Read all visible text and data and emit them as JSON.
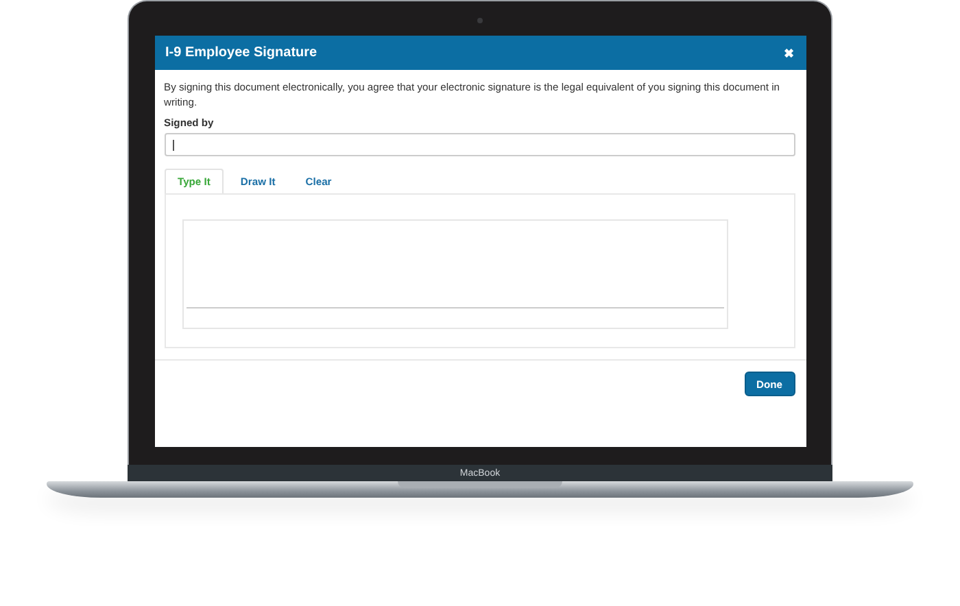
{
  "device": {
    "brand": "MacBook"
  },
  "dialog": {
    "title": "I-9 Employee Signature",
    "close": "✖",
    "description": "By signing this document electronically, you agree that your electronic signature is the legal equivalent of you signing this document in writing.",
    "field": {
      "label": "Signed by",
      "focused": true
    },
    "tabs": [
      {
        "label": "Type It",
        "selected": true
      },
      {
        "label": "Draw It",
        "selected": false
      },
      {
        "label": "Clear",
        "selected": false
      }
    ],
    "buttons": [
      "Done"
    ]
  }
}
